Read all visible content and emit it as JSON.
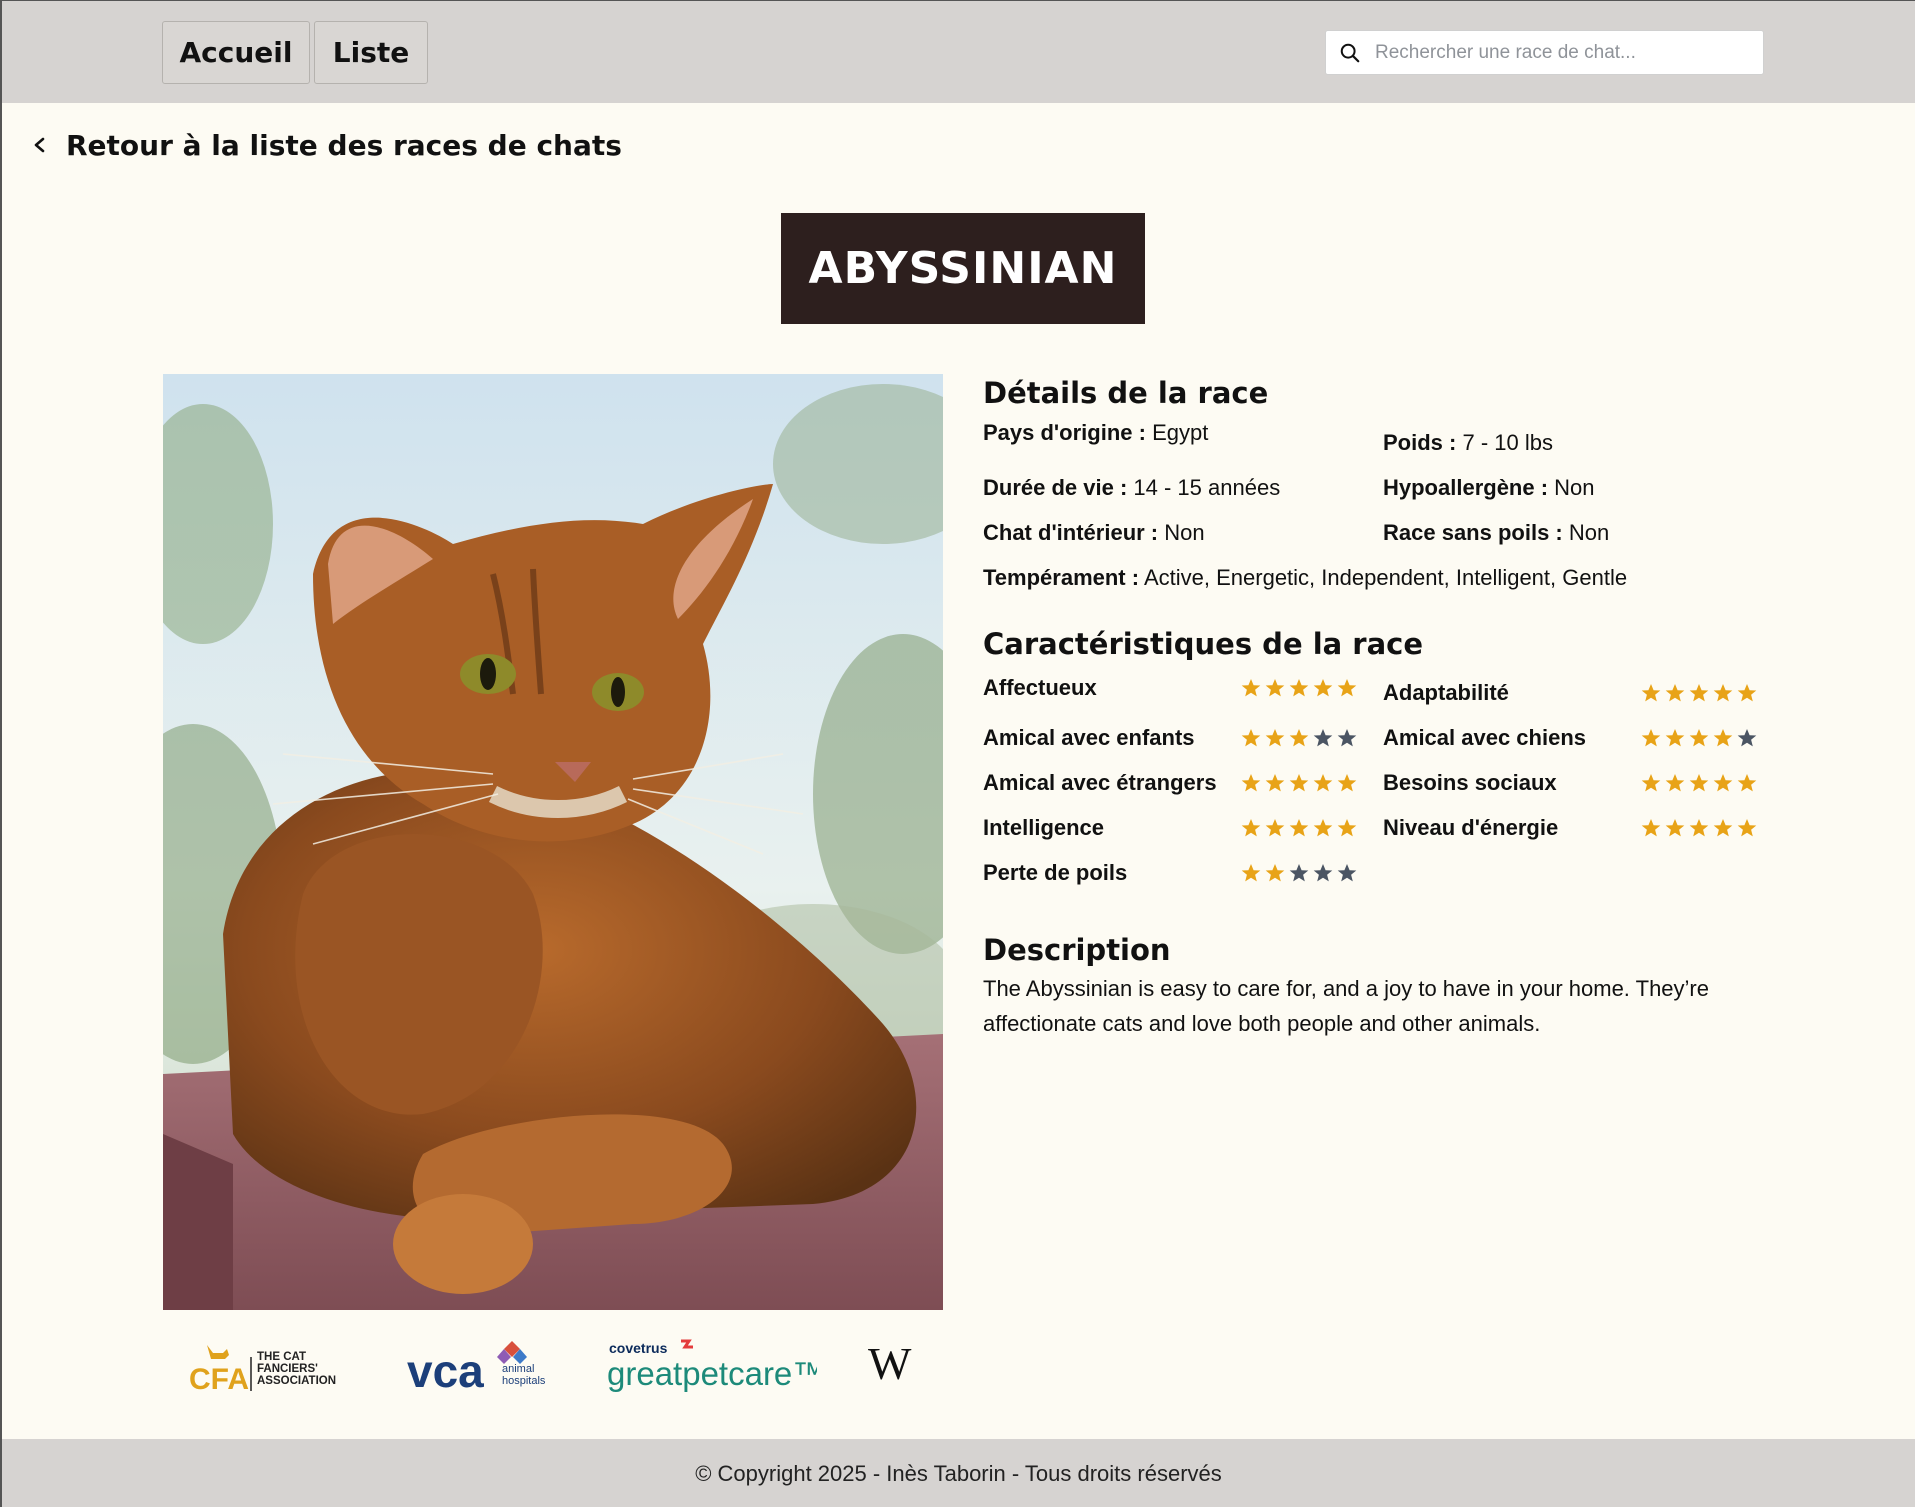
{
  "nav": {
    "home_label": "Accueil",
    "list_label": "Liste",
    "search_placeholder": "Rechercher une race de chat..."
  },
  "back_link": "Retour à la liste des races de chats",
  "breed": {
    "name": "ABYSSINIAN",
    "image_alt": "Abyssinian cat"
  },
  "details": {
    "title": "Détails de la race",
    "origin_label": "Pays d'origine :",
    "origin_value": "Egypt",
    "weight_label": "Poids :",
    "weight_value": "7 - 10 lbs",
    "lifespan_label": "Durée de vie :",
    "lifespan_value": "14 - 15 années",
    "hypo_label": "Hypoallergène :",
    "hypo_value": "Non",
    "indoor_label": "Chat d'intérieur :",
    "indoor_value": "Non",
    "hairless_label": "Race sans poils :",
    "hairless_value": "Non",
    "temperament_label": "Tempérament :",
    "temperament_value": "Active, Energetic, Independent, Intelligent, Gentle"
  },
  "characteristics": {
    "title": "Caractéristiques de la race",
    "items": [
      {
        "label": "Affectueux",
        "rating": 5
      },
      {
        "label": "Adaptabilité",
        "rating": 5
      },
      {
        "label": "Amical avec enfants",
        "rating": 3
      },
      {
        "label": "Amical avec chiens",
        "rating": 4
      },
      {
        "label": "Amical avec étrangers",
        "rating": 5
      },
      {
        "label": "Besoins sociaux",
        "rating": 5
      },
      {
        "label": "Intelligence",
        "rating": 5
      },
      {
        "label": "Niveau d'énergie",
        "rating": 5
      },
      {
        "label": "Perte de poils",
        "rating": 2
      }
    ],
    "max_rating": 5,
    "colors": {
      "filled": "#e8a317",
      "empty": "#4b5563"
    }
  },
  "description": {
    "title": "Description",
    "text": "The Abyssinian is easy to care for, and a joy to have in your home. They’re affectionate cats and love both people and other animals."
  },
  "sources": [
    {
      "name": "cfa-logo",
      "text_main": "CFA",
      "text_sub": "THE CAT FANCIERS' ASSOCIATION"
    },
    {
      "name": "vca-logo",
      "text_main": "vca",
      "text_sub": "animal hospitals"
    },
    {
      "name": "great-pet-care-logo",
      "text_main": "greatpetcare™",
      "text_sub": "covetrus"
    },
    {
      "name": "wikipedia-logo",
      "text_main": "W"
    }
  ],
  "footer": "© Copyright 2025 - Inès Taborin - Tous droits réservés"
}
